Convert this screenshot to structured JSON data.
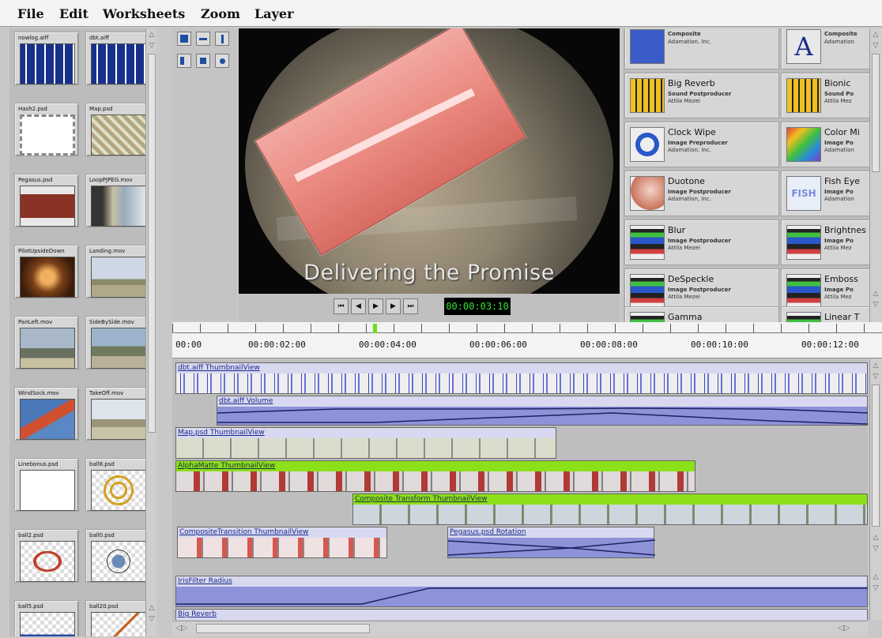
{
  "menu": [
    "File",
    "Edit",
    "Worksheets",
    "Zoom",
    "Layer"
  ],
  "assets": [
    {
      "name": "nowlog.aiff",
      "kind": "audio"
    },
    {
      "name": "dbt.aiff",
      "kind": "audio"
    },
    {
      "name": "Hash2.psd",
      "kind": "blank"
    },
    {
      "name": "Map.psd",
      "kind": "map"
    },
    {
      "name": "Pegasus.psd",
      "kind": "brown"
    },
    {
      "name": "LoopPJPEG.mov",
      "kind": "rainbow"
    },
    {
      "name": "PilotUpsideDown",
      "kind": "pilot"
    },
    {
      "name": "Landing.mov",
      "kind": "sky"
    },
    {
      "name": "PanLeft.mov",
      "kind": "sky2"
    },
    {
      "name": "SideBySide.mov",
      "kind": "sky3"
    },
    {
      "name": "WindSock.mov",
      "kind": "windsock"
    },
    {
      "name": "TakeOff.mov",
      "kind": "takeoff"
    },
    {
      "name": "Linebonus.psd",
      "kind": "blank"
    },
    {
      "name": "ball8.psd",
      "kind": "rings"
    },
    {
      "name": "ball2.psd",
      "kind": "circle"
    },
    {
      "name": "ball0.psd",
      "kind": "star"
    },
    {
      "name": "ball5.psd",
      "kind": "car"
    },
    {
      "name": "ball20.psd",
      "kind": "check"
    }
  ],
  "viewer": {
    "caption": "Delivering the Promise",
    "timecode": "00:00:03:10",
    "controls": [
      "⏮",
      "◀",
      "▶",
      "▶",
      "⏭"
    ]
  },
  "effects": [
    {
      "name": "",
      "type": "Composite",
      "vendor": "Adamation, Inc.",
      "icon": "blue"
    },
    {
      "name": "",
      "type": "Composite",
      "vendor": "Adamation",
      "icon": "letterA"
    },
    {
      "name": "Big Reverb",
      "type": "Sound Postproducer",
      "vendor": "Attila Mezei",
      "icon": "circuit"
    },
    {
      "name": "Bionic",
      "type": "Sound Po",
      "vendor": "Attila Mez",
      "icon": "circuit"
    },
    {
      "name": "Clock Wipe",
      "type": "Image Preproducer",
      "vendor": "Adamation, Inc.",
      "icon": "ring"
    },
    {
      "name": "Color Mi",
      "type": "Image Po",
      "vendor": "Adamation",
      "icon": "rainbow"
    },
    {
      "name": "Duotone",
      "type": "Image Postproducer",
      "vendor": "Adamation, Inc.",
      "icon": "duotone"
    },
    {
      "name": "Fish Eye",
      "type": "Image Po",
      "vendor": "Adamation",
      "icon": "fish"
    },
    {
      "name": "Blur",
      "type": "Image Postproducer",
      "vendor": "Attila Mezei",
      "icon": "stack"
    },
    {
      "name": "Brightnes",
      "type": "Image Po",
      "vendor": "Attila Mez",
      "icon": "stack"
    },
    {
      "name": "DeSpeckle",
      "type": "Image Postproducer",
      "vendor": "Attila Mezei",
      "icon": "stack"
    },
    {
      "name": "Emboss",
      "type": "Image Po",
      "vendor": "Attila Mez",
      "icon": "stack"
    },
    {
      "name": "Gamma",
      "type": "",
      "vendor": "",
      "icon": "stack"
    },
    {
      "name": "Linear T",
      "type": "",
      "vendor": "",
      "icon": "stack"
    }
  ],
  "ruler": {
    "labels": [
      "00:00",
      "00:00:02:00",
      "00:00:04:00",
      "00:00:06:00",
      "00:00:08:00",
      "00:00:10:00",
      "00:00:12:00"
    ]
  },
  "tracks": [
    {
      "label": "dbt.aiff ThumbnailView",
      "style": "lav",
      "fill": "wave"
    },
    {
      "label": "dbt.aiff Volume",
      "style": "lav",
      "fill": "auto"
    },
    {
      "label": "Map.psd ThumbnailView",
      "style": "lav",
      "fill": "frames"
    },
    {
      "label": "AlphaMatte ThumbnailView",
      "style": "grn",
      "fill": "frames red"
    },
    {
      "label": "Composite Transform ThumbnailView",
      "style": "grn",
      "fill": "frames sky"
    },
    {
      "label": "CompositeTransition ThumbnailView",
      "style": "lav",
      "fill": "frames pink"
    },
    {
      "label": "Pegasus.psd Rotation",
      "style": "lav",
      "fill": "auto"
    },
    {
      "label": "IrisFilter Radius",
      "style": "lav",
      "fill": "auto"
    },
    {
      "label": "Big Reverb",
      "style": "lav",
      "fill": "auto"
    }
  ]
}
